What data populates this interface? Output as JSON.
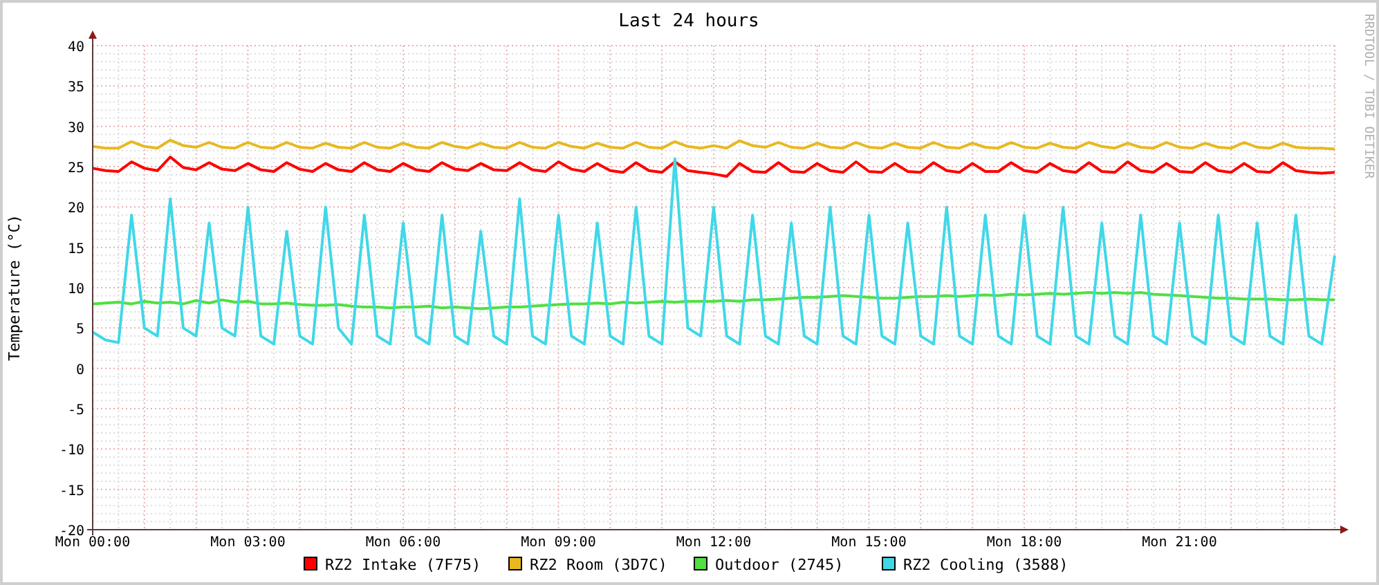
{
  "graph": {
    "watermark_text": "RRDTOOL / TOBI OETIKER",
    "chart_data": {
      "type": "line",
      "title": "Last 24 hours",
      "ylabel": "Temperature (°C)",
      "categories": [
        "Mon 00:00",
        null,
        null,
        null,
        null,
        null,
        null,
        null,
        null,
        null,
        null,
        null,
        "Mon 03:00",
        null,
        null,
        null,
        null,
        null,
        null,
        null,
        null,
        null,
        null,
        null,
        "Mon 06:00",
        null,
        null,
        null,
        null,
        null,
        null,
        null,
        null,
        null,
        null,
        null,
        "Mon 09:00",
        null,
        null,
        null,
        null,
        null,
        null,
        null,
        null,
        null,
        null,
        null,
        "Mon 12:00",
        null,
        null,
        null,
        null,
        null,
        null,
        null,
        null,
        null,
        null,
        null,
        "Mon 15:00",
        null,
        null,
        null,
        null,
        null,
        null,
        null,
        null,
        null,
        null,
        null,
        "Mon 18:00",
        null,
        null,
        null,
        null,
        null,
        null,
        null,
        null,
        null,
        null,
        null,
        "Mon 21:00",
        null,
        null,
        null,
        null,
        null,
        null,
        null,
        null,
        null,
        null,
        null,
        null
      ],
      "ylim": [
        -20,
        40
      ],
      "grid": true,
      "legend": "bottom",
      "yticks": [
        -20,
        -15,
        -10,
        -5,
        0,
        5,
        10,
        15,
        20,
        25,
        30,
        35,
        40
      ],
      "series": [
        {
          "name": "RZ2 Intake (7F75)",
          "color": "#ff0000",
          "values": [
            24.8,
            24.5,
            24.4,
            25.6,
            24.8,
            24.5,
            26.2,
            24.9,
            24.6,
            25.5,
            24.7,
            24.5,
            25.4,
            24.6,
            24.4,
            25.5,
            24.7,
            24.4,
            25.4,
            24.6,
            24.4,
            25.5,
            24.6,
            24.4,
            25.4,
            24.6,
            24.4,
            25.5,
            24.7,
            24.5,
            25.4,
            24.6,
            24.5,
            25.5,
            24.6,
            24.4,
            25.6,
            24.7,
            24.4,
            25.4,
            24.5,
            24.3,
            25.5,
            24.5,
            24.3,
            25.6,
            24.5,
            24.3,
            24.1,
            23.8,
            25.4,
            24.4,
            24.3,
            25.5,
            24.4,
            24.3,
            25.4,
            24.5,
            24.3,
            25.6,
            24.4,
            24.3,
            25.4,
            24.4,
            24.3,
            25.5,
            24.5,
            24.3,
            25.4,
            24.4,
            24.4,
            25.5,
            24.5,
            24.3,
            25.4,
            24.5,
            24.3,
            25.5,
            24.4,
            24.3,
            25.6,
            24.5,
            24.3,
            25.4,
            24.4,
            24.3,
            25.5,
            24.5,
            24.3,
            25.4,
            24.4,
            24.3,
            25.5,
            24.5,
            24.3,
            24.2,
            24.3
          ]
        },
        {
          "name": "RZ2 Room (3D7C)",
          "color": "#e8b820",
          "values": [
            27.5,
            27.3,
            27.3,
            28.1,
            27.5,
            27.3,
            28.3,
            27.6,
            27.4,
            28.0,
            27.4,
            27.3,
            28.0,
            27.4,
            27.3,
            28.0,
            27.4,
            27.3,
            27.9,
            27.4,
            27.3,
            28.0,
            27.4,
            27.3,
            27.9,
            27.4,
            27.3,
            28.0,
            27.5,
            27.3,
            27.9,
            27.4,
            27.3,
            28.0,
            27.4,
            27.3,
            28.0,
            27.5,
            27.3,
            27.9,
            27.4,
            27.3,
            28.0,
            27.4,
            27.3,
            28.1,
            27.5,
            27.3,
            27.6,
            27.3,
            28.2,
            27.6,
            27.4,
            28.0,
            27.4,
            27.3,
            27.9,
            27.4,
            27.3,
            28.0,
            27.4,
            27.3,
            27.9,
            27.4,
            27.3,
            28.0,
            27.4,
            27.3,
            27.9,
            27.4,
            27.3,
            28.0,
            27.4,
            27.3,
            27.9,
            27.4,
            27.3,
            28.0,
            27.5,
            27.3,
            27.9,
            27.4,
            27.3,
            28.0,
            27.4,
            27.3,
            27.9,
            27.4,
            27.3,
            28.0,
            27.4,
            27.3,
            27.9,
            27.4,
            27.3,
            27.3,
            27.2
          ]
        },
        {
          "name": "Outdoor (2745)",
          "color": "#50e040",
          "values": [
            8.0,
            8.1,
            8.2,
            8.0,
            8.3,
            8.1,
            8.2,
            8.0,
            8.4,
            8.1,
            8.5,
            8.2,
            8.3,
            8.0,
            8.0,
            8.1,
            7.9,
            7.8,
            7.8,
            7.9,
            7.7,
            7.6,
            7.6,
            7.5,
            7.6,
            7.6,
            7.7,
            7.5,
            7.6,
            7.5,
            7.4,
            7.5,
            7.6,
            7.6,
            7.7,
            7.8,
            7.9,
            8.0,
            8.0,
            8.1,
            8.0,
            8.2,
            8.1,
            8.2,
            8.3,
            8.2,
            8.3,
            8.3,
            8.3,
            8.4,
            8.3,
            8.5,
            8.5,
            8.6,
            8.7,
            8.8,
            8.8,
            8.9,
            9.0,
            8.9,
            8.8,
            8.7,
            8.7,
            8.8,
            8.9,
            8.9,
            9.0,
            8.9,
            9.0,
            9.1,
            9.0,
            9.2,
            9.1,
            9.2,
            9.3,
            9.2,
            9.3,
            9.4,
            9.3,
            9.4,
            9.3,
            9.4,
            9.2,
            9.1,
            9.0,
            8.9,
            8.8,
            8.7,
            8.7,
            8.6,
            8.6,
            8.6,
            8.5,
            8.5,
            8.6,
            8.5,
            8.5
          ]
        },
        {
          "name": "RZ2 Cooling (3588)",
          "color": "#40d8e8",
          "values": [
            4.5,
            3.5,
            3.2,
            19,
            5,
            4,
            21,
            5,
            4,
            18,
            5,
            4,
            20,
            4,
            3,
            17,
            4,
            3,
            20,
            5,
            3,
            19,
            4,
            3,
            18,
            4,
            3,
            19,
            4,
            3,
            17,
            4,
            3,
            21,
            4,
            3,
            19,
            4,
            3,
            18,
            4,
            3,
            20,
            4,
            3,
            26,
            5,
            4,
            20,
            4,
            3,
            19,
            4,
            3,
            18,
            4,
            3,
            20,
            4,
            3,
            19,
            4,
            3,
            18,
            4,
            3,
            20,
            4,
            3,
            19,
            4,
            3,
            19,
            4,
            3,
            20,
            4,
            3,
            18,
            4,
            3,
            19,
            4,
            3,
            18,
            4,
            3,
            19,
            4,
            3,
            18,
            4,
            3,
            19,
            4,
            3,
            14
          ]
        }
      ]
    }
  }
}
